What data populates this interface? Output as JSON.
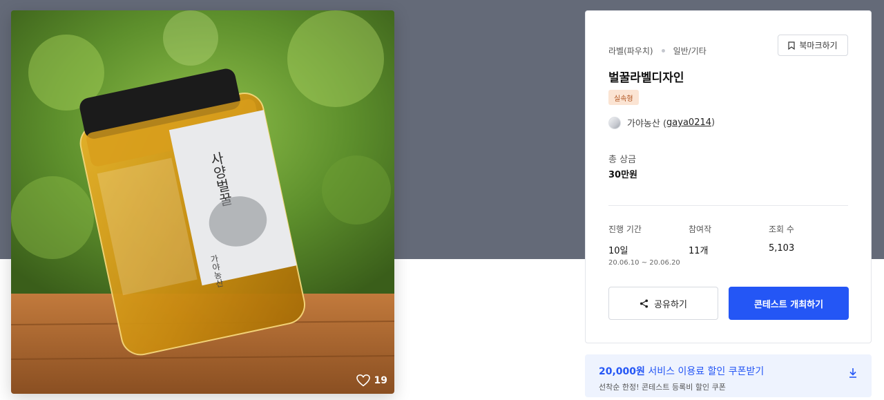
{
  "product": {
    "likes": "19",
    "image_label_text": "사양벌꿀",
    "image_brand_text": "가야농산"
  },
  "info": {
    "category": "라벨(파우치)",
    "subcategory": "일반/기타",
    "bookmark_label": "북마크하기",
    "title": "벌꿀라벨디자인",
    "badge": "실속형",
    "host_name": "가야농산 (",
    "host_id": "gaya0214",
    "host_close": ")",
    "prize_label": "총 상금",
    "prize_value": "30만원",
    "stats": {
      "period_label": "진행 기간",
      "period_value": "10일",
      "period_range": "20.06.10 ~ 20.06.20",
      "participants_label": "참여작",
      "participants_value": "11개",
      "views_label": "조회 수",
      "views_value": "5,103"
    },
    "share_label": "공유하기",
    "host_contest_label": "콘테스트 개최하기"
  },
  "coupon": {
    "title_bold": "20,000원",
    "title_rest": " 서비스 이용료 할인 쿠폰받기",
    "subtitle": "선착순 한정! 콘테스트 등록비 할인 쿠폰"
  },
  "colors": {
    "accent": "#2456f5",
    "hero_bg": "#646a78",
    "badge_bg": "#fbe4d3",
    "coupon_bg": "#eef3fe"
  },
  "icons": {
    "bookmark": "bookmark-icon",
    "share": "share-icon",
    "heart": "heart-icon",
    "download": "download-icon"
  }
}
